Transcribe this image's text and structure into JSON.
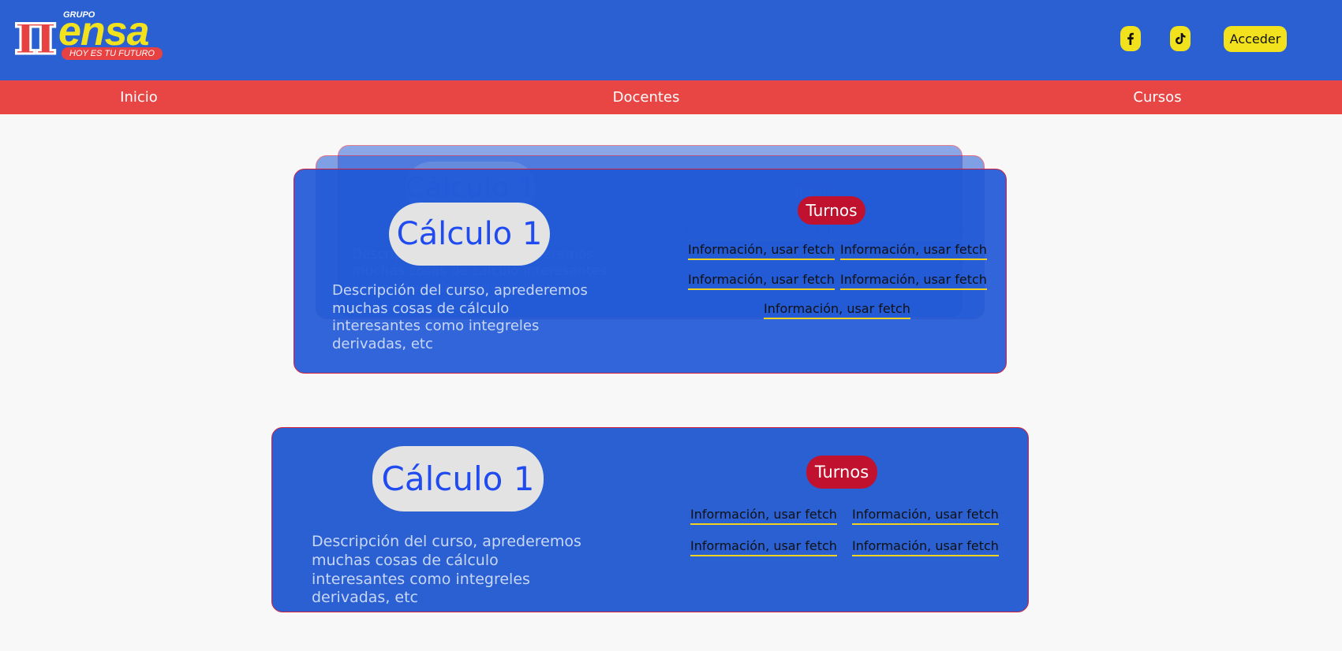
{
  "brand": {
    "logo_pi": "π",
    "logo_grupo": "GRUPO",
    "logo_name": "ensa",
    "logo_slogan": "HOY ES TU FUTURO",
    "accent_blue": "#2a60d2",
    "accent_red": "#e84545",
    "accent_yellow": "#f2e21e"
  },
  "header": {
    "social_icons": [
      "facebook-icon",
      "tiktok-icon"
    ],
    "login_label": "Acceder"
  },
  "nav": {
    "items": [
      "Inicio",
      "Docentes",
      "Cursos"
    ]
  },
  "courses": [
    {
      "title": "Cálculo 1",
      "description": "Descripción del curso, aprederemos muchas cosas de cálculo interesantes como integreles derivadas, etc",
      "turnos_label": "Turnos",
      "links": [
        "Información, usar fetch",
        "Información, usar fetch",
        "Información, usar fetch",
        "Información, usar fetch",
        "Información, usar fetch"
      ]
    },
    {
      "title": "Cálculo 1",
      "description": "Descripción del curso, aprederemos muchas cosas de cálculo interesantes como integreles derivadas, etc",
      "turnos_label": "Turnos",
      "links": [
        "Información, usar fetch",
        "Información, usar fetch",
        "Información, usar fetch",
        "Información, usar fetch"
      ]
    }
  ]
}
